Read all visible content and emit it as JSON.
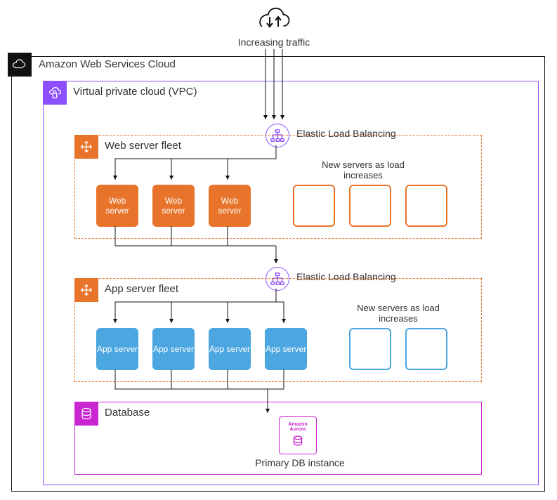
{
  "traffic_label": "Increasing traffic",
  "aws_title": "Amazon Web Services Cloud",
  "vpc_title": "Virtual private cloud (VPC)",
  "elb_label": "Elastic Load Balancing",
  "web_fleet": {
    "title": "Web server fleet",
    "server_label": "Web server",
    "new_label": "New servers as load increases",
    "filled": 3,
    "ghosts": 3
  },
  "app_fleet": {
    "title": "App server fleet",
    "server_label": "App server",
    "new_label": "New servers as load increases",
    "filled": 4,
    "ghosts": 2
  },
  "db": {
    "title": "Database",
    "aurora_line1": "Amazon",
    "aurora_line2": "Aurora",
    "instance_label": "Primary DB instance"
  },
  "colors": {
    "aws_border": "#111111",
    "vpc": "#8C4FFF",
    "autoscale": "#E8742C",
    "ec2_web": "#E8742C",
    "ec2_app": "#4CA6E0",
    "db": "#C925D1"
  }
}
